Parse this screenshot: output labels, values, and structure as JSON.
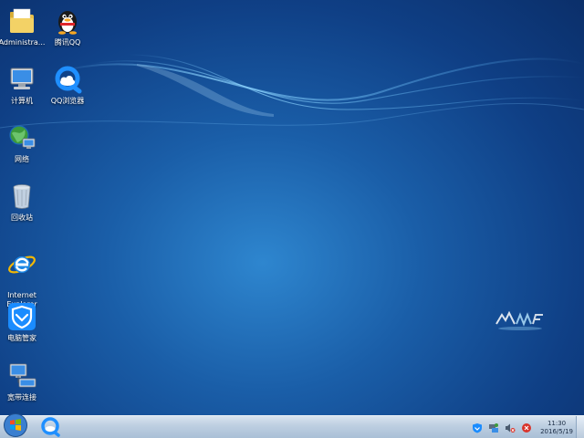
{
  "desktop": {
    "icons": [
      {
        "label": "Administra...",
        "icon": "user-folder-icon"
      },
      {
        "label": "腾讯QQ",
        "icon": "qq-penguin-icon"
      },
      {
        "label": "计算机",
        "icon": "computer-icon"
      },
      {
        "label": "QQ浏览器",
        "icon": "qq-browser-icon"
      },
      {
        "label": "网络",
        "icon": "network-icon"
      },
      {
        "label": "回收站",
        "icon": "recycle-bin-icon"
      },
      {
        "label": "Internet\nExplorer",
        "icon": "ie-icon"
      },
      {
        "label": "电脑管家",
        "icon": "pc-manager-shield-icon"
      },
      {
        "label": "宽带连接",
        "icon": "broadband-connection-icon"
      }
    ],
    "brand_logo": "ylmf-logo"
  },
  "taskbar": {
    "start_icon": "windows-orb-icon",
    "pinned_app_icon": "qq-browser-icon",
    "tray_icons": [
      "shield-icon",
      "network-status-icon",
      "volume-muted-icon",
      "alert-icon"
    ],
    "clock": {
      "time": "11:30",
      "date": "2016/5/19"
    }
  },
  "colors": {
    "wallpaper_center": "#2e86cf",
    "wallpaper_edge": "#0b2f6a",
    "taskbar": "#bfd0e2"
  }
}
